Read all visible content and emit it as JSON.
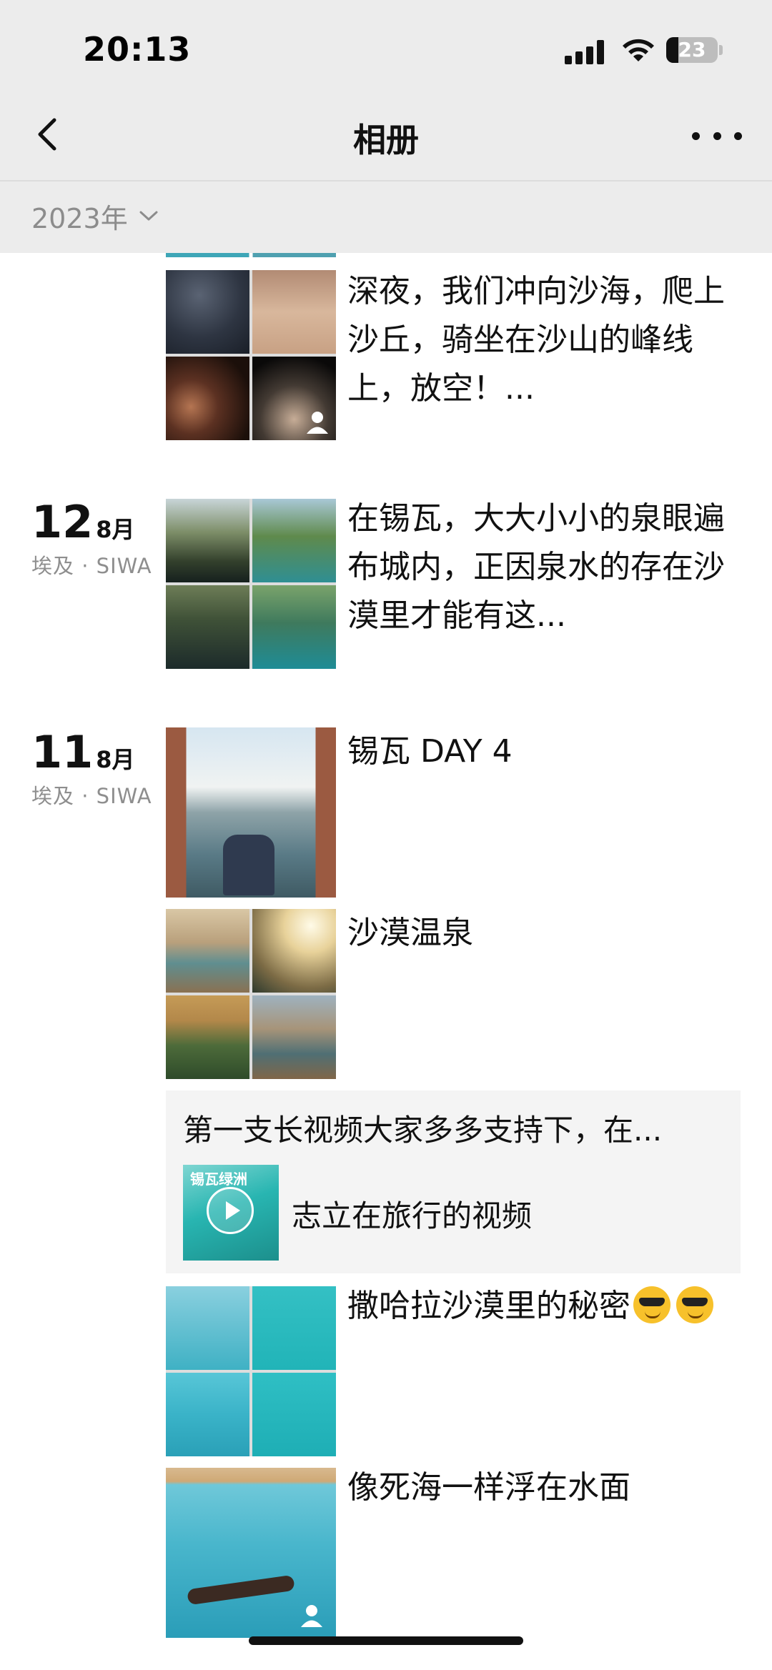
{
  "status_bar": {
    "time": "20:13",
    "battery": "23",
    "battery_level": 0.23
  },
  "nav": {
    "title": "相册",
    "back_icon": "chevron-left-icon",
    "more_icon": "more-dots-icon"
  },
  "filter": {
    "year": "2023年"
  },
  "posts": [
    {
      "text": "深夜，我们冲向沙海，爬上沙丘，骑坐在沙山的峰线上，放空！..."
    },
    {
      "day": "12",
      "month": "8月",
      "location": "埃及 · SIWA",
      "text": "在锡瓦，大大小小的泉眼遍布城内，正因泉水的存在沙漠里才能有这..."
    },
    {
      "day": "11",
      "month": "8月",
      "location": "埃及 · SIWA",
      "text": "锡瓦 DAY 4"
    },
    {
      "text": "沙漠温泉"
    },
    {
      "share_title": "第一支长视频大家多多支持下，在...",
      "share_thumb_caption": "锡瓦绿洲",
      "share_label": "志立在旅行的视频"
    },
    {
      "text": "撒哈拉沙漠里的秘密"
    },
    {
      "text": "像死海一样浮在水面"
    }
  ]
}
